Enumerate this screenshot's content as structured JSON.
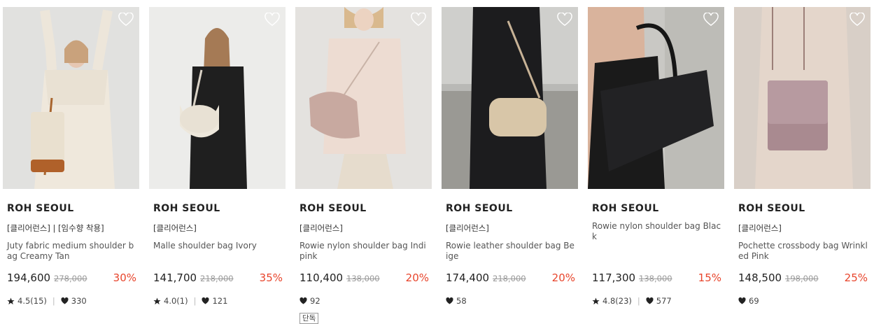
{
  "products": [
    {
      "brand": "ROH SEOUL",
      "tags": "[클리어런스] | [임수향 착용]",
      "name": "Juty fabric medium shoulder bag Creamy Tan",
      "price": "194,600",
      "original_price": "278,000",
      "discount": "30%",
      "rating": "4.5(15)",
      "likes": "330",
      "badge": ""
    },
    {
      "brand": "ROH SEOUL",
      "tags": "[클리어런스]",
      "name": "Malle shoulder bag Ivory",
      "price": "141,700",
      "original_price": "218,000",
      "discount": "35%",
      "rating": "4.0(1)",
      "likes": "121",
      "badge": ""
    },
    {
      "brand": "ROH SEOUL",
      "tags": "[클리어런스]",
      "name": "Rowie nylon shoulder bag Indipink",
      "price": "110,400",
      "original_price": "138,000",
      "discount": "20%",
      "rating": "",
      "likes": "92",
      "badge": "단독"
    },
    {
      "brand": "ROH SEOUL",
      "tags": "[클리어런스]",
      "name": "Rowie leather shoulder bag Beige",
      "price": "174,400",
      "original_price": "218,000",
      "discount": "20%",
      "rating": "",
      "likes": "58",
      "badge": ""
    },
    {
      "brand": "ROH SEOUL",
      "tags": "",
      "name": "Rowie nylon shoulder bag Black",
      "price": "117,300",
      "original_price": "138,000",
      "discount": "15%",
      "rating": "4.8(23)",
      "likes": "577",
      "badge": ""
    },
    {
      "brand": "ROH SEOUL",
      "tags": "[클리어런스]",
      "name": "Pochette crossbody bag Wrinkled Pink",
      "price": "148,500",
      "original_price": "198,000",
      "discount": "25%",
      "rating": "",
      "likes": "69",
      "badge": ""
    }
  ],
  "colors": {
    "discount": "#e8452c",
    "text": "#222222",
    "muted": "#999999"
  },
  "icons": {
    "wishlist": "heart-outline-icon",
    "rating": "star-icon",
    "likes": "heart-filled-icon"
  }
}
